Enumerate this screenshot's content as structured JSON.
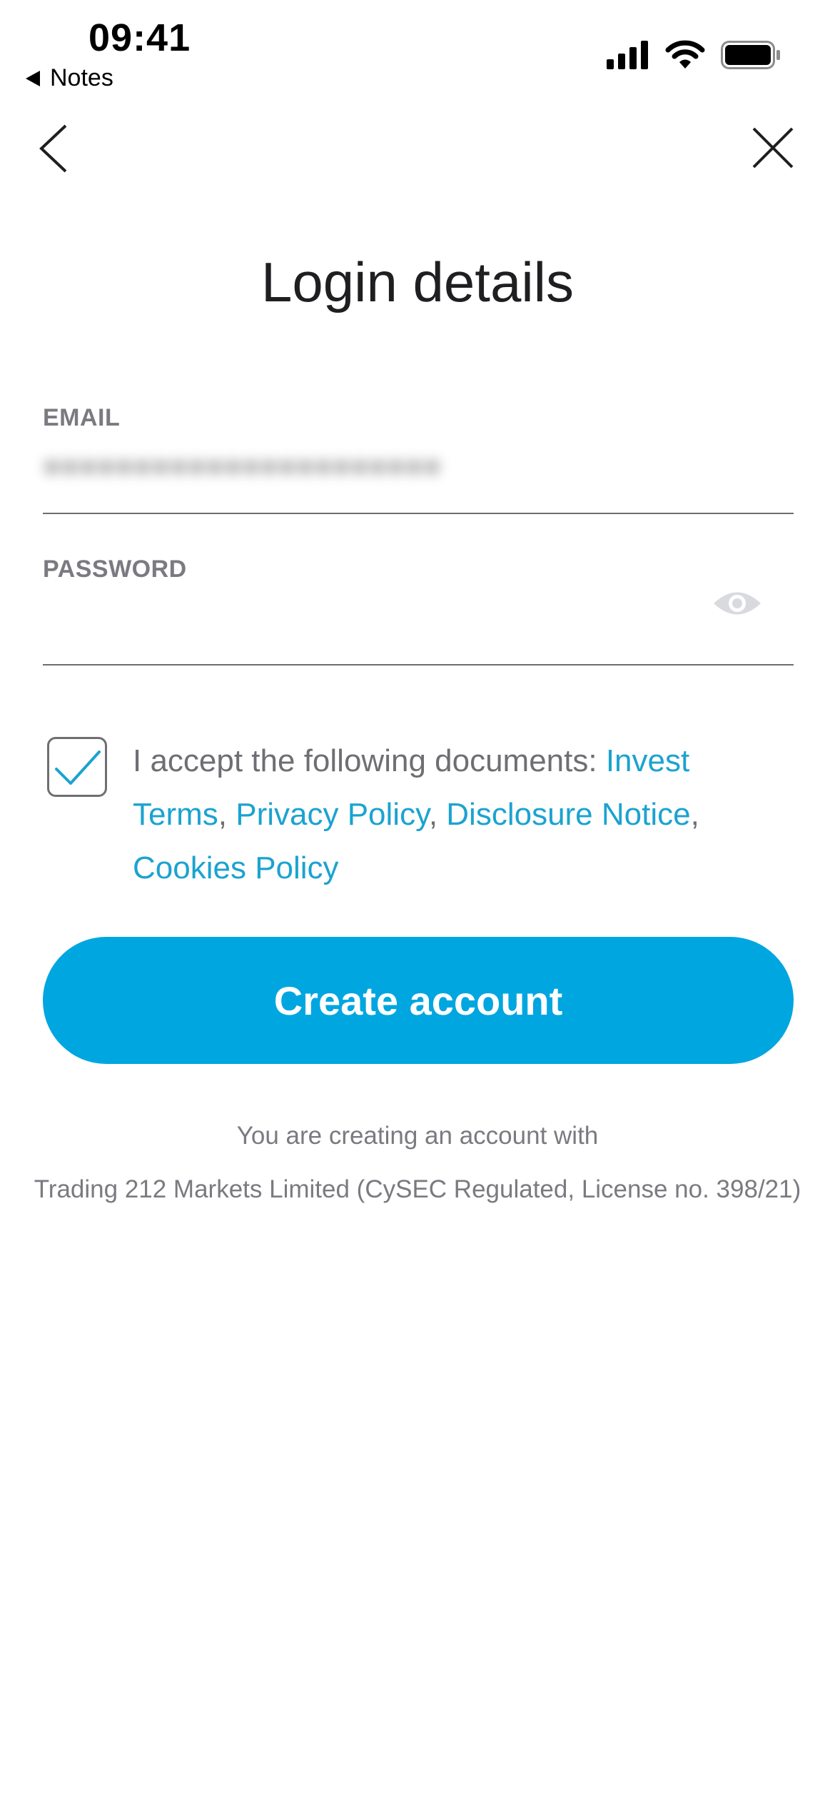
{
  "status_bar": {
    "time": "09:41",
    "back_app_label": "Notes",
    "icons": [
      "cellular-signal-icon",
      "wifi-icon",
      "battery-icon"
    ]
  },
  "nav": {
    "back_icon": "chevron-left-icon",
    "close_icon": "close-icon"
  },
  "title": "Login details",
  "email": {
    "label": "EMAIL",
    "value": "●●●●●●●●●●●●●●●●●●●●●●"
  },
  "password": {
    "label": "PASSWORD",
    "value": "",
    "toggle_icon": "eye-icon"
  },
  "terms": {
    "checked": true,
    "prefix": "I accept the following documents: ",
    "links": [
      "Invest Terms",
      "Privacy Policy",
      "Disclosure Notice",
      "Cookies Policy"
    ],
    "separator": ", "
  },
  "cta_label": "Create account",
  "footnote": {
    "line1": "You are creating an account with",
    "line2": "Trading 212 Markets Limited (CySEC Regulated, License no. 398/21)"
  },
  "colors": {
    "accent": "#00a6e0",
    "link": "#1ba3d0",
    "label": "#7a7a80"
  }
}
